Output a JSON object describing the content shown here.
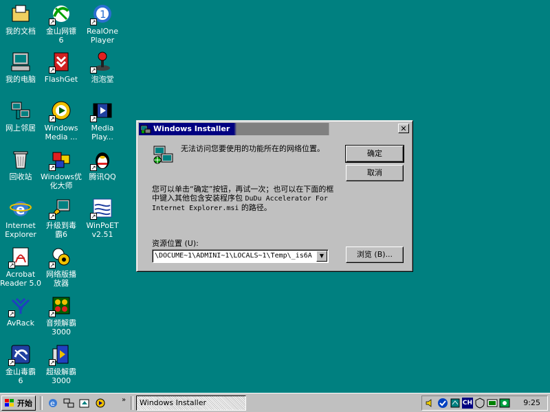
{
  "desktop": {
    "icons": [
      {
        "label": "我的文档",
        "icon": "my-documents-icon",
        "shortcut": false
      },
      {
        "label": "金山网镖\n6",
        "icon": "kingsoft-firewall-icon",
        "shortcut": true
      },
      {
        "label": "RealOne\nPlayer",
        "icon": "realone-player-icon",
        "shortcut": true
      },
      {
        "label": "我的电脑",
        "icon": "my-computer-icon",
        "shortcut": false
      },
      {
        "label": "FlashGet",
        "icon": "flashget-icon",
        "shortcut": true
      },
      {
        "label": "泡泡堂",
        "icon": "joystick-icon",
        "shortcut": true
      },
      {
        "label": "网上邻居",
        "icon": "network-neighborhood-icon",
        "shortcut": false
      },
      {
        "label": "Windows\nMedia ...",
        "icon": "windows-media-icon",
        "shortcut": true
      },
      {
        "label": "Media\nPlay...",
        "icon": "media-player-icon",
        "shortcut": true
      },
      {
        "label": "回收站",
        "icon": "recycle-bin-icon",
        "shortcut": false
      },
      {
        "label": "Windows优\n化大师",
        "icon": "windows-optimizer-icon",
        "shortcut": true
      },
      {
        "label": "腾讯QQ",
        "icon": "qq-penguin-icon",
        "shortcut": true
      },
      {
        "label": "Internet\nExplorer",
        "icon": "internet-explorer-icon",
        "shortcut": false
      },
      {
        "label": "升级到毒\n霸6",
        "icon": "upgrade-antivirus-icon",
        "shortcut": true
      },
      {
        "label": "WinPoET\nv2.51",
        "icon": "winpoet-icon",
        "shortcut": true
      },
      {
        "label": "Acrobat\nReader 5.0",
        "icon": "acrobat-reader-icon",
        "shortcut": true
      },
      {
        "label": "网络版播\n放器",
        "icon": "network-player-icon",
        "shortcut": true
      },
      {
        "label": "AvRack",
        "icon": "avrack-icon",
        "shortcut": true
      },
      {
        "label": "音频解霸\n3000",
        "icon": "audio-player-icon",
        "shortcut": true
      },
      {
        "label": "金山毒霸\n6",
        "icon": "kingsoft-antivirus-icon",
        "shortcut": true
      },
      {
        "label": "超级解霸\n3000",
        "icon": "super-player-icon",
        "shortcut": true
      }
    ]
  },
  "dialog": {
    "title": "Windows Installer",
    "close_label": "✕",
    "message1": "无法访问您要使用的功能所在的网络位置。",
    "message2_prefix": "您可以单击“确定”按钮，再试一次；也可以在下面的框中键入其他包含安装程序包 ",
    "message2_file": "DuDu Accelerator For Internet Explorer.msi",
    "message2_suffix": " 的路径。",
    "ok_label": "确定",
    "cancel_label": "取消",
    "location_label": "资源位置 (U):",
    "location_value": "\\DOCUME~1\\ADMINI~1\\LOCALS~1\\Temp\\_is6A",
    "browse_label": "浏览 (B)..."
  },
  "taskbar": {
    "start_label": "开始",
    "quicklaunch_overflow": "»",
    "active_task": "Windows Installer",
    "tray_lang": "CH",
    "clock": "9:25"
  },
  "colors": {
    "desktop": "#008080",
    "title_active": "#000080",
    "window_face": "#c0c0c0"
  }
}
